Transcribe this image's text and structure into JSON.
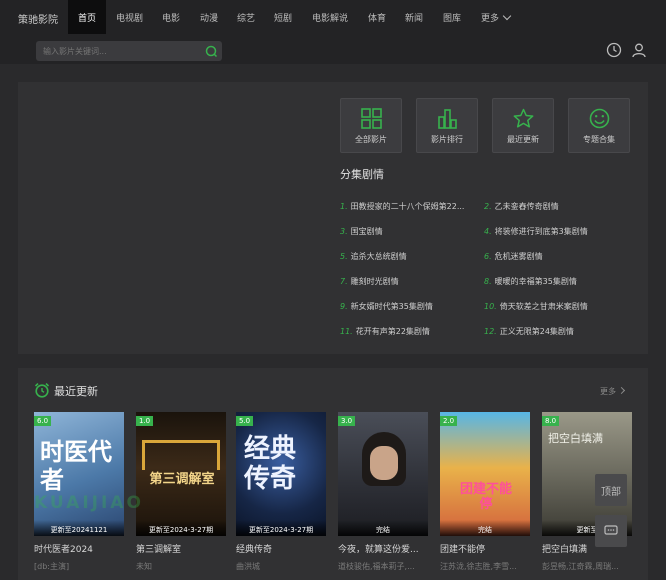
{
  "brand": "策驰影院",
  "nav": [
    {
      "label": "首页",
      "active": true
    },
    {
      "label": "电视剧"
    },
    {
      "label": "电影"
    },
    {
      "label": "动漫"
    },
    {
      "label": "综艺"
    },
    {
      "label": "短剧"
    },
    {
      "label": "电影解说"
    },
    {
      "label": "体育"
    },
    {
      "label": "新闻"
    },
    {
      "label": "图库"
    },
    {
      "label": "更多"
    }
  ],
  "search": {
    "placeholder": "输入影片关键词..."
  },
  "quick": [
    {
      "label": "全部影片",
      "icon": "grid-icon"
    },
    {
      "label": "影片排行",
      "icon": "bar-chart-icon"
    },
    {
      "label": "最近更新",
      "icon": "star-icon"
    },
    {
      "label": "专题合集",
      "icon": "smile-icon"
    }
  ],
  "episodes_title": "分集剧情",
  "episodes": [
    {
      "num": "1.",
      "title": "田教授家的二十八个保姆第22..."
    },
    {
      "num": "2.",
      "title": "乙未銮舂传奇剧情"
    },
    {
      "num": "3.",
      "title": "国宝剧情"
    },
    {
      "num": "4.",
      "title": "将装修进行到底第3集剧情"
    },
    {
      "num": "5.",
      "title": "追杀大总统剧情"
    },
    {
      "num": "6.",
      "title": "危机迷雾剧情"
    },
    {
      "num": "7.",
      "title": "雕刻时光剧情"
    },
    {
      "num": "8.",
      "title": "暖暖的幸福第35集剧情"
    },
    {
      "num": "9.",
      "title": "新女婿时代第35集剧情"
    },
    {
      "num": "10.",
      "title": "倚天软差之甘肃米案剧情"
    },
    {
      "num": "11.",
      "title": "花开有声第22集剧情"
    },
    {
      "num": "12.",
      "title": "正义无限第24集剧情"
    }
  ],
  "latest": {
    "title": "最近更新",
    "more": "更多",
    "cards": [
      {
        "score": "6.0",
        "status": "更新至20241121",
        "title": "时代医者2024",
        "actors": "[db:主演]",
        "poster_text": "时医代者",
        "bg": "#5b86b8"
      },
      {
        "score": "1.0",
        "status": "更新至2024-3-27期",
        "title": "第三调解室",
        "actors": "未知",
        "poster_text": "第三调解室",
        "bg": "#3a2a1c"
      },
      {
        "score": "5.0",
        "status": "更新至2024-3-27期",
        "title": "经典传奇",
        "actors": "曲洪城",
        "poster_text": "经典传奇",
        "bg": "#1b2c52"
      },
      {
        "score": "3.0",
        "status": "完结",
        "title": "今夜，就算这份爱...",
        "actors": "道枝骏佑,福本莉子,...",
        "poster_text": "",
        "bg": "#3a3d44"
      },
      {
        "score": "2.0",
        "status": "完结",
        "title": "团建不能停",
        "actors": "汪苏泷,徐志胜,李雪...",
        "poster_text": "团建不能停",
        "bg": "#d48a3a"
      },
      {
        "score": "8.0",
        "status": "更新至",
        "title": "把空白填满",
        "actors": "彭昱畅,江奇霖,周瑞...",
        "poster_text": "把空白填满",
        "bg": "#6b6a5e"
      }
    ]
  },
  "watermark": "KUAIJIAO",
  "floating": [
    "顶部",
    "留言"
  ]
}
